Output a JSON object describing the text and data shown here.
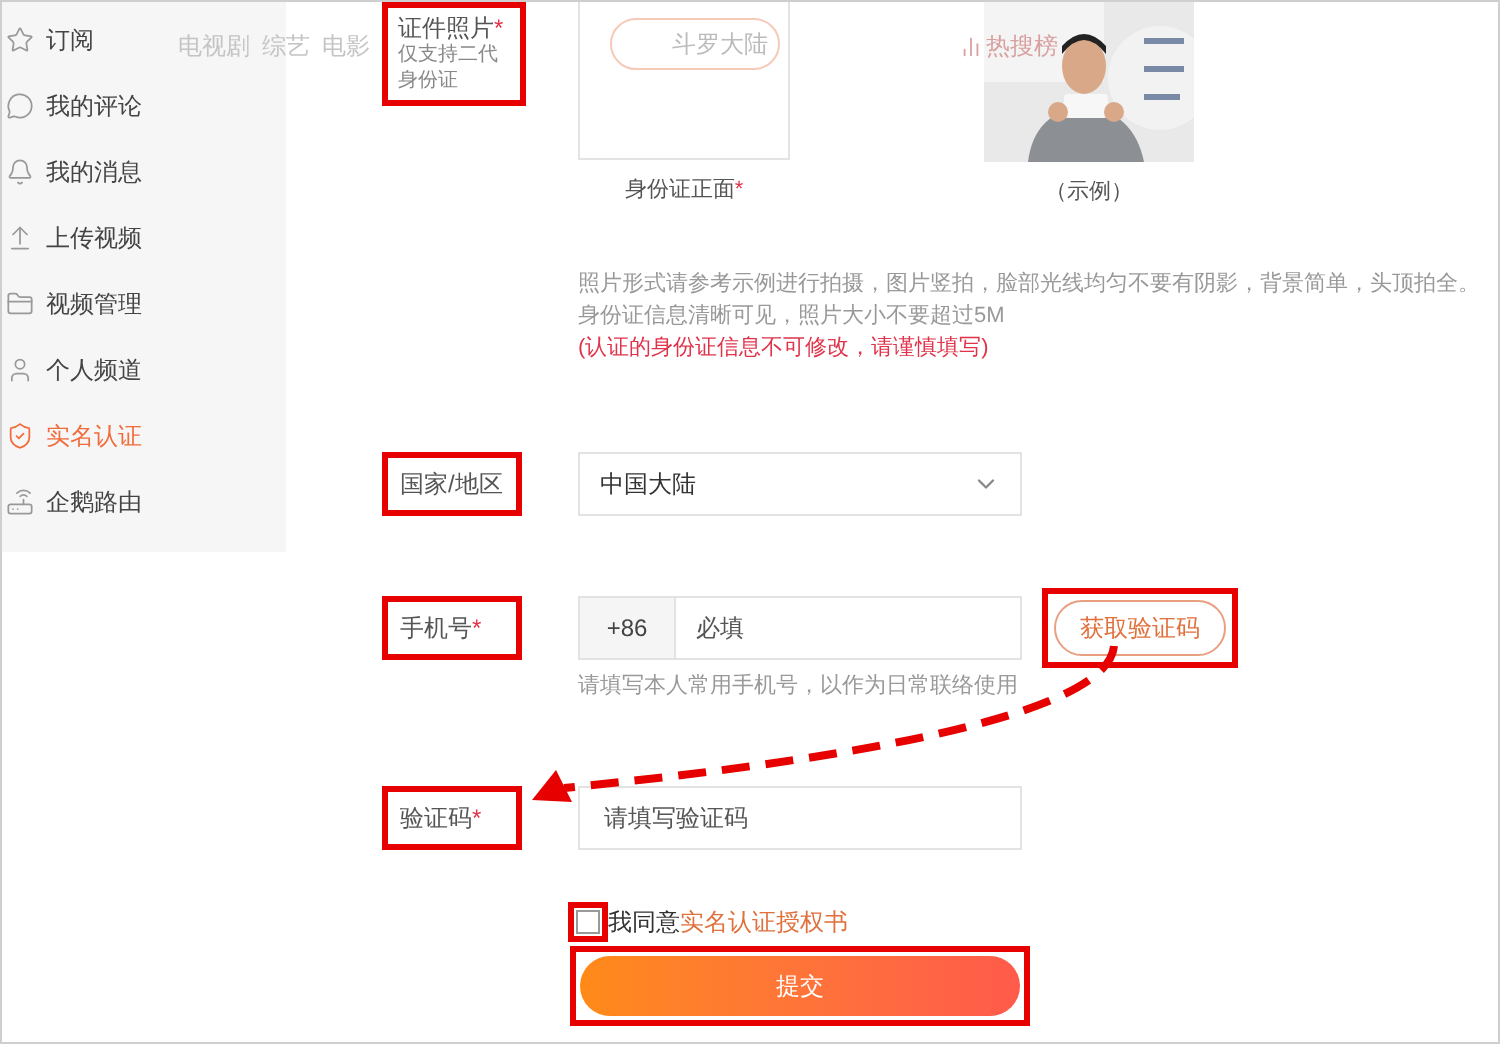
{
  "header": {
    "nav": [
      "电视剧",
      "综艺",
      "电影"
    ],
    "search_placeholder": "斗罗大陆",
    "hot_search": "热搜榜"
  },
  "sidebar": {
    "items": [
      {
        "label": "订阅",
        "selected": false
      },
      {
        "label": "我的评论",
        "selected": false
      },
      {
        "label": "我的消息",
        "selected": false
      },
      {
        "label": "上传视频",
        "selected": false
      },
      {
        "label": "视频管理",
        "selected": false
      },
      {
        "label": "个人频道",
        "selected": false
      },
      {
        "label": "实名认证",
        "selected": true
      },
      {
        "label": "企鹅路由",
        "selected": false
      }
    ]
  },
  "form": {
    "id_photo": {
      "label": "证件照片",
      "required_mark": "*",
      "highlighted": true,
      "note": "仅支持二代身份证",
      "front_caption": "身份证正面",
      "front_required_mark": "*",
      "example_caption": "（示例）",
      "hints": [
        "照片形式请参考示例进行拍摄，图片竖拍，脸部光线均匀不要有阴影，背景简单，头顶拍全。",
        "身份证信息清晰可见，照片大小不要超过5M"
      ],
      "warning": "(认证的身份证信息不可修改，请谨慎填写)"
    },
    "region": {
      "label": "国家/地区",
      "highlighted": true,
      "value": "中国大陆"
    },
    "phone": {
      "label": "手机号",
      "required_mark": "*",
      "highlighted": true,
      "prefix": "+86",
      "placeholder": "必填",
      "hint": "请填写本人常用手机号，以作为日常联络使用",
      "code_button": "获取验证码",
      "code_button_highlighted": true
    },
    "code": {
      "label": "验证码",
      "required_mark": "*",
      "highlighted": true,
      "placeholder": "请填写验证码"
    },
    "agree": {
      "checked": false,
      "highlighted": true,
      "text": "我同意",
      "link": "实名认证授权书"
    },
    "submit": {
      "label": "提交",
      "highlighted": true
    }
  }
}
